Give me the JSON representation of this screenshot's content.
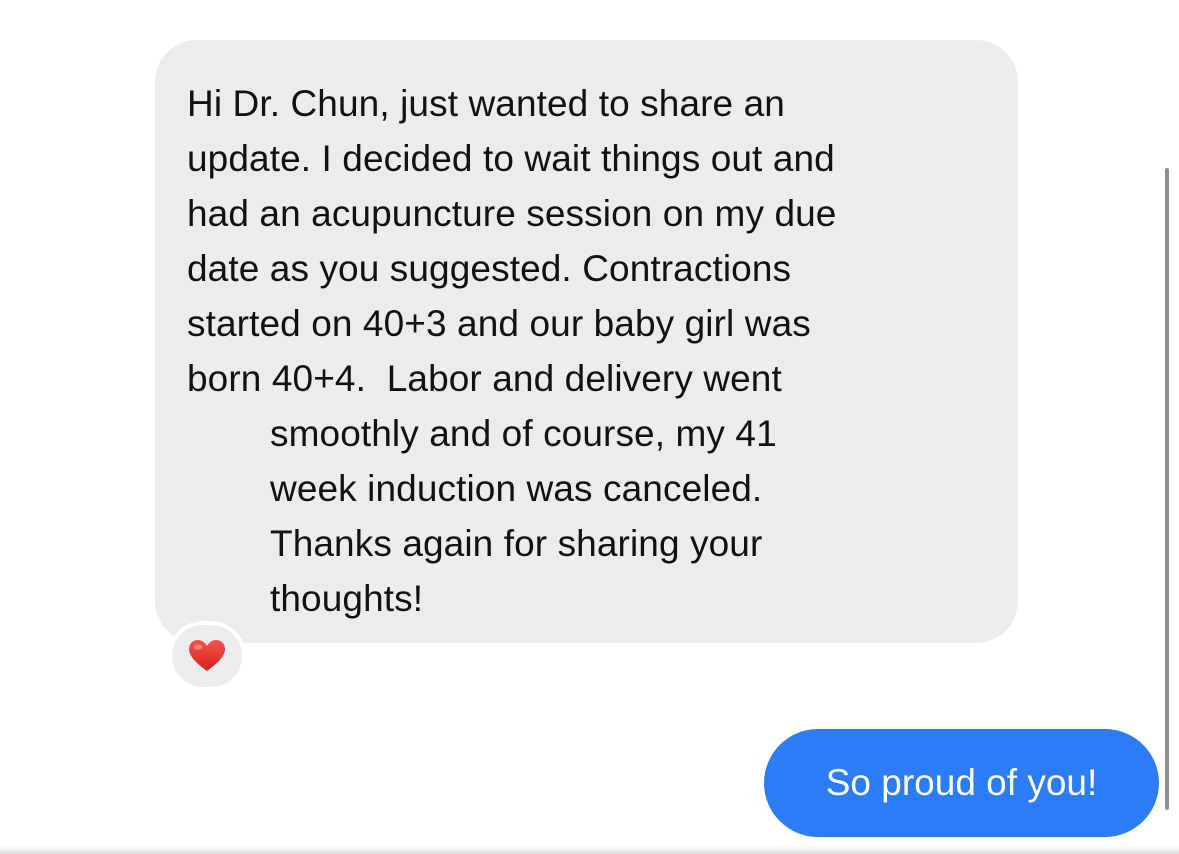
{
  "thread": {
    "incoming_message": {
      "lines": [
        "Hi Dr. Chun, just wanted to share an",
        "update. I decided to wait things out and",
        "had an acupuncture session on my due",
        "date as you suggested. Contractions",
        "started on 40+3 and our baby girl was",
        "born 40+4.  Labor and delivery went",
        "smoothly and of course, my 41",
        "week induction was canceled.",
        "Thanks again for sharing your",
        "thoughts!"
      ],
      "reaction": "heart-icon"
    },
    "outgoing_message": {
      "text": "So proud of you!"
    }
  },
  "colors": {
    "incoming_bubble": "#ececee",
    "outgoing_bubble": "#2c7cf6",
    "heart": "#e8302a",
    "scrollbar": "#8e8e93"
  }
}
